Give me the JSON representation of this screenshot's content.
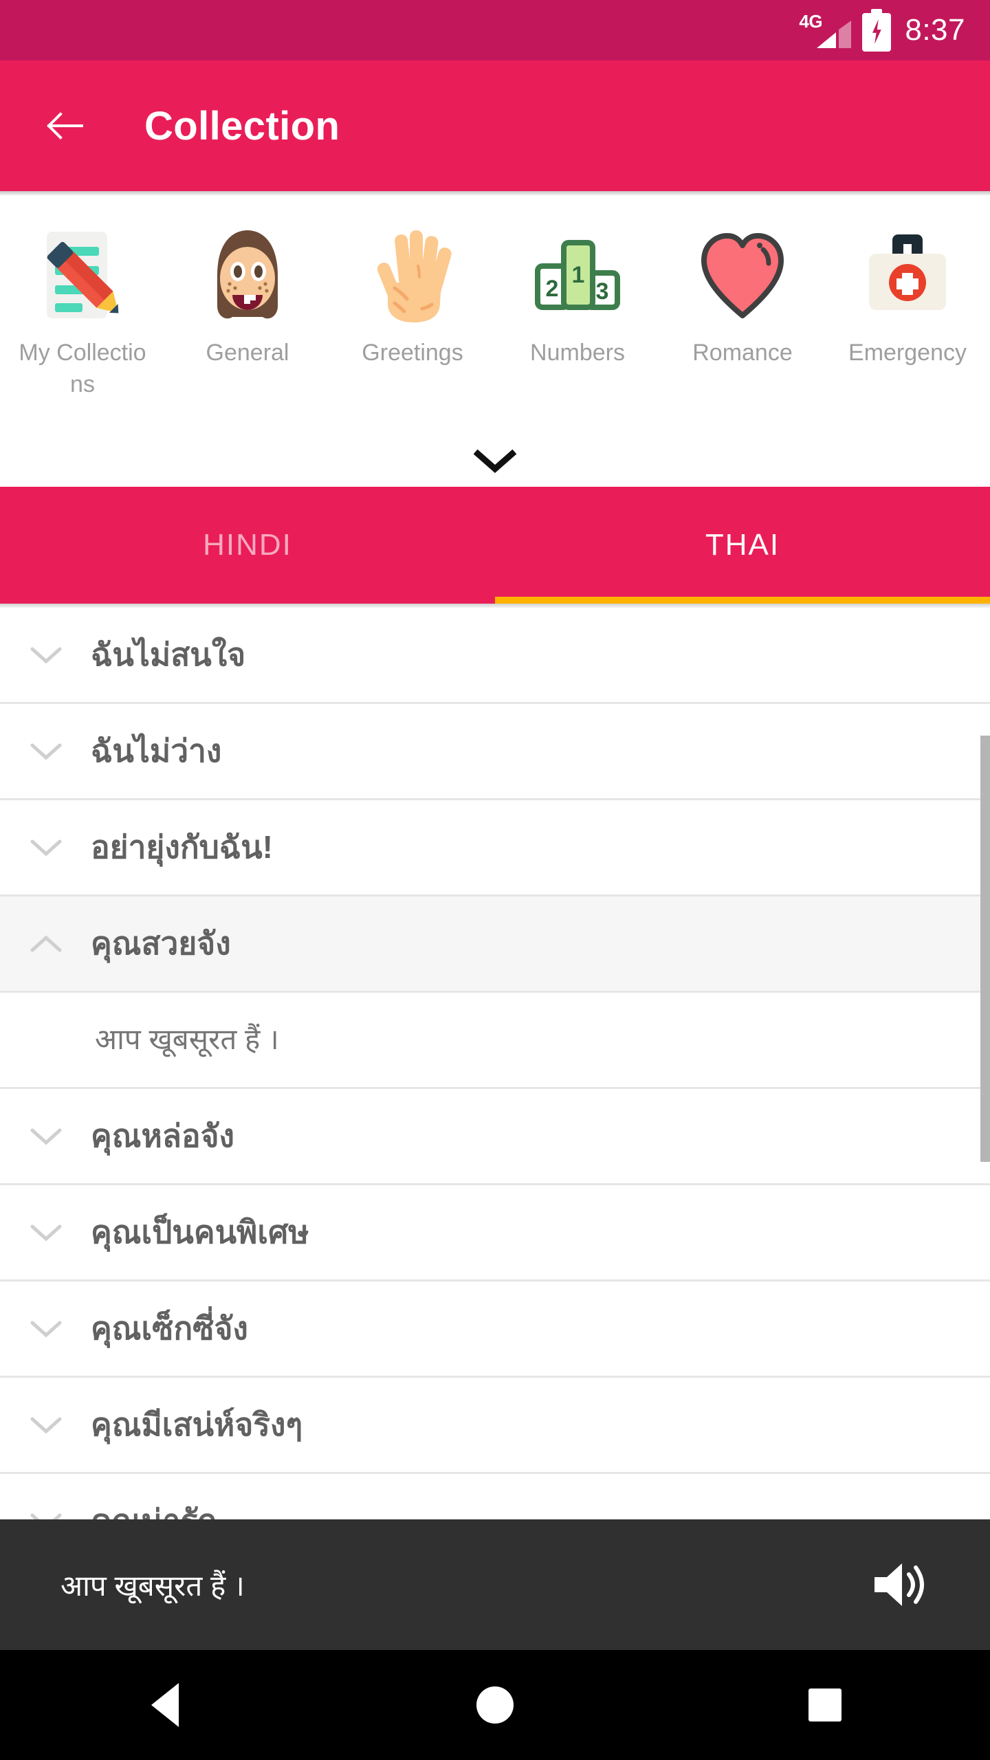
{
  "status_bar": {
    "network_label": "4G",
    "signal_icon": "signal-bars-icon",
    "battery_icon": "battery-charging-icon",
    "time": "8:37"
  },
  "app_bar": {
    "back_icon": "arrow-left-icon",
    "title": "Collection",
    "background_color": "#e91e58"
  },
  "categories": {
    "expand_icon": "chevron-down-icon",
    "items": [
      {
        "label": "My Collections",
        "icon": "memo-pencil-emoji"
      },
      {
        "label": "General",
        "icon": "girl-face-emoji"
      },
      {
        "label": "Greetings",
        "icon": "open-hand-emoji"
      },
      {
        "label": "Numbers",
        "icon": "podium-123-emoji"
      },
      {
        "label": "Romance",
        "icon": "heart-emoji"
      },
      {
        "label": "Emergency",
        "icon": "first-aid-kit-emoji"
      }
    ]
  },
  "tabs": {
    "indicator_color": "#ffb300",
    "items": [
      {
        "label": "HINDI",
        "active": false
      },
      {
        "label": "THAI",
        "active": true
      }
    ]
  },
  "phrase_list": {
    "chevron_collapsed_icon": "chevron-down-icon",
    "chevron_expanded_icon": "chevron-up-icon",
    "rows": [
      {
        "type": "phrase",
        "text": "ฉันไม่สนใจ",
        "expanded": false
      },
      {
        "type": "phrase",
        "text": "ฉันไม่ว่าง",
        "expanded": false
      },
      {
        "type": "phrase",
        "text": "อย่ายุ่งกับฉัน!",
        "expanded": false
      },
      {
        "type": "phrase",
        "text": "คุณสวยจัง",
        "expanded": true
      },
      {
        "type": "translation",
        "text": "आप खूबसूरत हैं ।"
      },
      {
        "type": "phrase",
        "text": "คุณหล่อจัง",
        "expanded": false
      },
      {
        "type": "phrase",
        "text": "คุณเป็นคนพิเศษ",
        "expanded": false
      },
      {
        "type": "phrase",
        "text": "คุณเซ็กซี่จัง",
        "expanded": false
      },
      {
        "type": "phrase",
        "text": "คุณมีเสน่ห์จริงๆ",
        "expanded": false
      },
      {
        "type": "phrase",
        "text": "คุณน่ารัก",
        "expanded": false
      }
    ]
  },
  "player_bar": {
    "text": "आप खूबसूरत हैं ।",
    "speaker_icon": "volume-up-icon",
    "background_color": "#303030"
  },
  "nav_bar": {
    "back_icon": "triangle-back-icon",
    "home_icon": "circle-home-icon",
    "recents_icon": "square-recents-icon"
  }
}
